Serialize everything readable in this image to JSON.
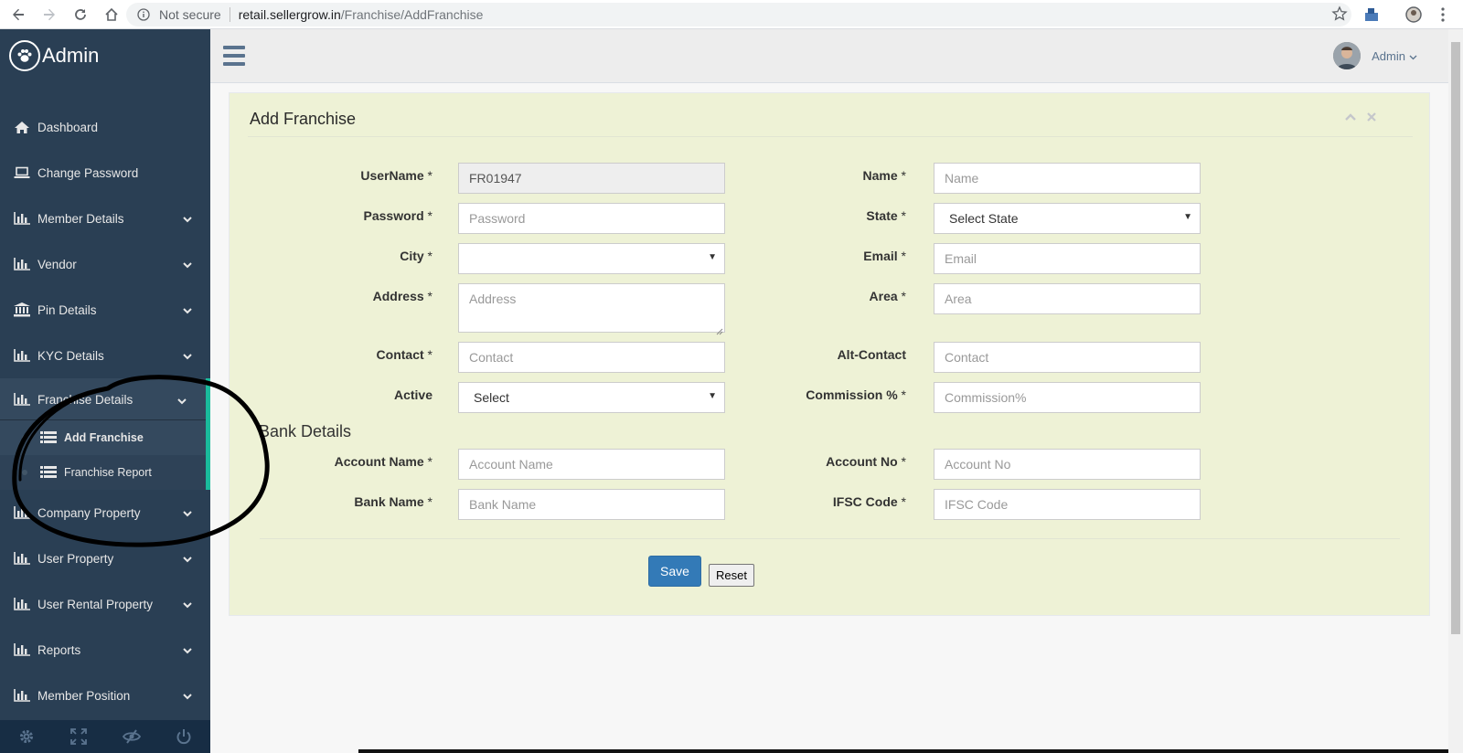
{
  "browser": {
    "not_secure": "Not secure",
    "url_host": "retail.sellergrow.in",
    "url_path": "/Franchise/AddFranchise"
  },
  "sidebar": {
    "brand": "Admin",
    "items": [
      {
        "label": "Dashboard",
        "icon": "home-icon"
      },
      {
        "label": "Change Password",
        "icon": "laptop-icon"
      },
      {
        "label": "Member Details",
        "icon": "bar-chart-icon"
      },
      {
        "label": "Vendor",
        "icon": "bar-chart-icon"
      },
      {
        "label": "Pin Details",
        "icon": "bank-icon"
      },
      {
        "label": "KYC Details",
        "icon": "bar-chart-icon"
      },
      {
        "label": "Franchise Details",
        "icon": "bar-chart-icon"
      },
      {
        "label": "Company Property",
        "icon": "bar-chart-icon"
      },
      {
        "label": "User Property",
        "icon": "bar-chart-icon"
      },
      {
        "label": "User Rental Property",
        "icon": "bar-chart-icon"
      },
      {
        "label": "Reports",
        "icon": "bar-chart-icon"
      },
      {
        "label": "Member Position",
        "icon": "bar-chart-icon"
      }
    ],
    "submenu": [
      {
        "label": "Add Franchise",
        "icon": "list-icon"
      },
      {
        "label": "Franchise Report",
        "icon": "list-icon"
      }
    ],
    "footer_icons": [
      "settings-icon",
      "fullscreen-icon",
      "eye-slash-icon",
      "power-icon"
    ]
  },
  "topnav": {
    "user": "Admin"
  },
  "panel": {
    "title": "Add Franchise",
    "bank_section": "Bank Details",
    "save_label": "Save",
    "reset_label": "Reset"
  },
  "form": {
    "username": {
      "label": "UserName",
      "req": " *",
      "value": "FR01947"
    },
    "name": {
      "label": "Name",
      "req": " *",
      "placeholder": "Name"
    },
    "password": {
      "label": "Password",
      "req": " *",
      "placeholder": "Password"
    },
    "state": {
      "label": "State",
      "req": " *",
      "value": "Select State"
    },
    "city": {
      "label": "City",
      "req": " *",
      "value": ""
    },
    "email": {
      "label": "Email",
      "req": " *",
      "placeholder": "Email"
    },
    "address": {
      "label": "Address",
      "req": " *",
      "placeholder": "Address"
    },
    "area": {
      "label": "Area",
      "req": " *",
      "placeholder": "Area"
    },
    "contact": {
      "label": "Contact",
      "req": " *",
      "placeholder": "Contact"
    },
    "alt_contact": {
      "label": "Alt-Contact",
      "req": "",
      "placeholder": "Contact"
    },
    "active": {
      "label": "Active",
      "req": "",
      "value": "Select"
    },
    "commission": {
      "label": "Commission %",
      "req": " *",
      "placeholder": "Commission%"
    },
    "account_name": {
      "label": "Account Name",
      "req": " *",
      "placeholder": "Account Name"
    },
    "account_no": {
      "label": "Account No",
      "req": " *",
      "placeholder": "Account No"
    },
    "bank_name": {
      "label": "Bank Name",
      "req": " *",
      "placeholder": "Bank Name"
    },
    "ifsc": {
      "label": "IFSC Code",
      "req": " *",
      "placeholder": "IFSC Code"
    }
  },
  "colors": {
    "sidebar": "#2a3f54",
    "accent": "#1abb9c",
    "panel": "#eef2d6",
    "primary": "#337ab7"
  }
}
